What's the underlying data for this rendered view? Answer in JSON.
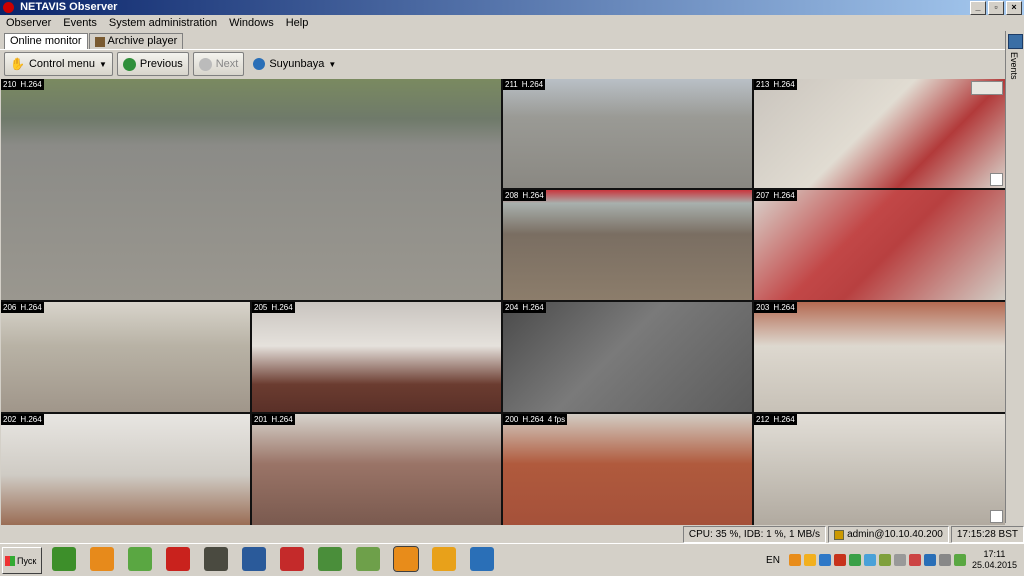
{
  "window": {
    "title": "NETAVIS Observer"
  },
  "menu": [
    "Observer",
    "Events",
    "System administration",
    "Windows",
    "Help"
  ],
  "tabs": [
    {
      "label": "Online monitor",
      "active": true
    },
    {
      "label": "Archive player",
      "active": false
    }
  ],
  "toolbar": {
    "control_menu": "Control menu",
    "previous": "Previous",
    "next": "Next",
    "layout": "Suyunbaya"
  },
  "side_panel": {
    "label": "Events"
  },
  "cameras": [
    {
      "id": "210",
      "codec": "H.264",
      "fps": "",
      "bg": "linear-gradient(180deg,#7a8a60 0%,#6f7a6a 18%,#8b8b87 30%,#9a978f 100%)"
    },
    {
      "id": "211",
      "codec": "H.264",
      "fps": "",
      "bg": "linear-gradient(180deg,#b9c0c6 0%,#9a9a95 35%,#8a8882 100%)"
    },
    {
      "id": "213",
      "codec": "H.264",
      "fps": "",
      "bg": "linear-gradient(135deg,#c9c4bd 0%,#e1dcd2 45%,#b23a3a 70%,#d8d4cc 100%)"
    },
    {
      "id": "208",
      "codec": "H.264",
      "fps": "",
      "bg": "linear-gradient(180deg,#c9363d 0%,#a8b0ad 12%,#7a6e62 40%,#8c7d6b 100%)"
    },
    {
      "id": "207",
      "codec": "H.264",
      "fps": "",
      "bg": "linear-gradient(135deg,#d9d6cf 0%,#c24747 40%,#b84040 55%,#d2cec6 100%)"
    },
    {
      "id": "206",
      "codec": "H.264",
      "fps": "",
      "bg": "linear-gradient(180deg,#d8d4cb 0%,#b8b2a5 40%,#a0968a 100%)"
    },
    {
      "id": "205",
      "codec": "H.264",
      "fps": "",
      "bg": "linear-gradient(180deg,#c9c4bf 0%,#e5e1dc 40%,#6b3c30 75%,#5a3028 100%)"
    },
    {
      "id": "204",
      "codec": "H.264",
      "fps": "",
      "bg": "linear-gradient(135deg,#4a4a4a 0%,#7a7a7a 45%,#5c5c5c 100%)"
    },
    {
      "id": "203",
      "codec": "H.264",
      "fps": "",
      "bg": "linear-gradient(180deg,#b46a52 0%,#ddd8cf 40%,#c7c1b7 100%)"
    },
    {
      "id": "202",
      "codec": "H.264",
      "fps": "",
      "bg": "linear-gradient(180deg,#e8e6e2 0%,#cfcbc4 55%,#9a6d55 100%)"
    },
    {
      "id": "201",
      "codec": "H.264",
      "fps": "",
      "bg": "linear-gradient(180deg,#d7d3cc 0%,#9a7467 45%,#7a5a4f 100%)"
    },
    {
      "id": "200",
      "codec": "H.264",
      "fps": "4 fps",
      "bg": "linear-gradient(180deg,#d2ccc3 0%,#b05a3d 45%,#a5513a 100%)"
    },
    {
      "id": "212",
      "codec": "H.264",
      "fps": "",
      "bg": "linear-gradient(180deg,#e2ded7 0%,#c9c4bb 50%,#b1aaa0 100%)"
    }
  ],
  "status": {
    "perf": "CPU: 35 %, IDB: 1 %, 1 MB/s",
    "user": "admin@10.10.40.200",
    "time": "17:15:28 BST"
  },
  "taskbar": {
    "start": "Пуск",
    "apps": [
      {
        "name": "talk-icon",
        "color": "#3d8f2a"
      },
      {
        "name": "paint-icon",
        "color": "#e78a1b"
      },
      {
        "name": "phone-icon",
        "color": "#5aa742"
      },
      {
        "name": "pdf-icon",
        "color": "#c9221d"
      },
      {
        "name": "tanks-icon",
        "color": "#4a4a40"
      },
      {
        "name": "network-icon",
        "color": "#2a5a9a"
      },
      {
        "name": "autocad-icon",
        "color": "#c42a2a"
      },
      {
        "name": "chrome-icon",
        "color": "#4a8e3a"
      },
      {
        "name": "editor-icon",
        "color": "#6ea04a"
      },
      {
        "name": "netavis-icon",
        "color": "#e88c1a"
      },
      {
        "name": "outlook-icon",
        "color": "#e8a11a"
      },
      {
        "name": "remote-icon",
        "color": "#2a6fb7"
      }
    ],
    "lang": "EN",
    "tray_colors": [
      "#e88c1a",
      "#f2b01f",
      "#2e78c7",
      "#c7331c",
      "#3aa048",
      "#4aa1d8",
      "#7fa03c",
      "#999999",
      "#c44",
      "#2a6fb7",
      "#888888",
      "#5aa742"
    ],
    "clock_time": "17:11",
    "clock_date": "25.04.2015"
  }
}
